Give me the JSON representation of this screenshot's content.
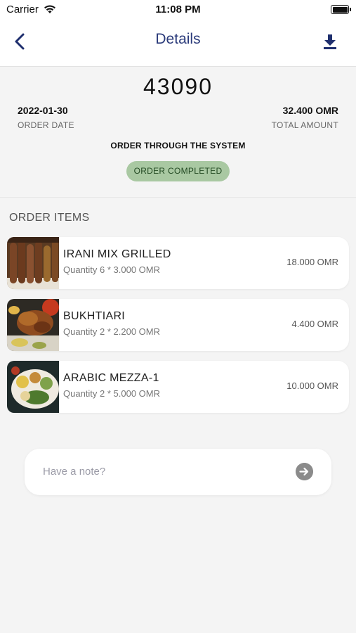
{
  "status_bar": {
    "carrier": "Carrier",
    "time": "11:08 PM"
  },
  "nav": {
    "title": "Details",
    "back_icon": "chevron-left-icon",
    "download_icon": "download-icon"
  },
  "order": {
    "number": "43090",
    "date": "2022-01-30",
    "date_label": "ORDER DATE",
    "total": "32.400 OMR",
    "total_label": "TOTAL AMOUNT",
    "source": "ORDER THROUGH THE SYSTEM",
    "status": "ORDER COMPLETED"
  },
  "items_section": {
    "title": "ORDER ITEMS",
    "items": [
      {
        "name": "IRANI MIX GRILLED",
        "qty": "Quantity 6 * 3.000 OMR",
        "price": "18.000 OMR"
      },
      {
        "name": "BUKHTIARI",
        "qty": "Quantity 2 * 2.200 OMR",
        "price": "4.400 OMR"
      },
      {
        "name": "ARABIC MEZZA-1",
        "qty": "Quantity 2 * 5.000 OMR",
        "price": "10.000 OMR"
      }
    ]
  },
  "note": {
    "placeholder": "Have a note?",
    "value": ""
  },
  "colors": {
    "nav_title": "#2a3a7a",
    "status_badge": "#a9c8a2",
    "accent": "#1f2f6e"
  }
}
